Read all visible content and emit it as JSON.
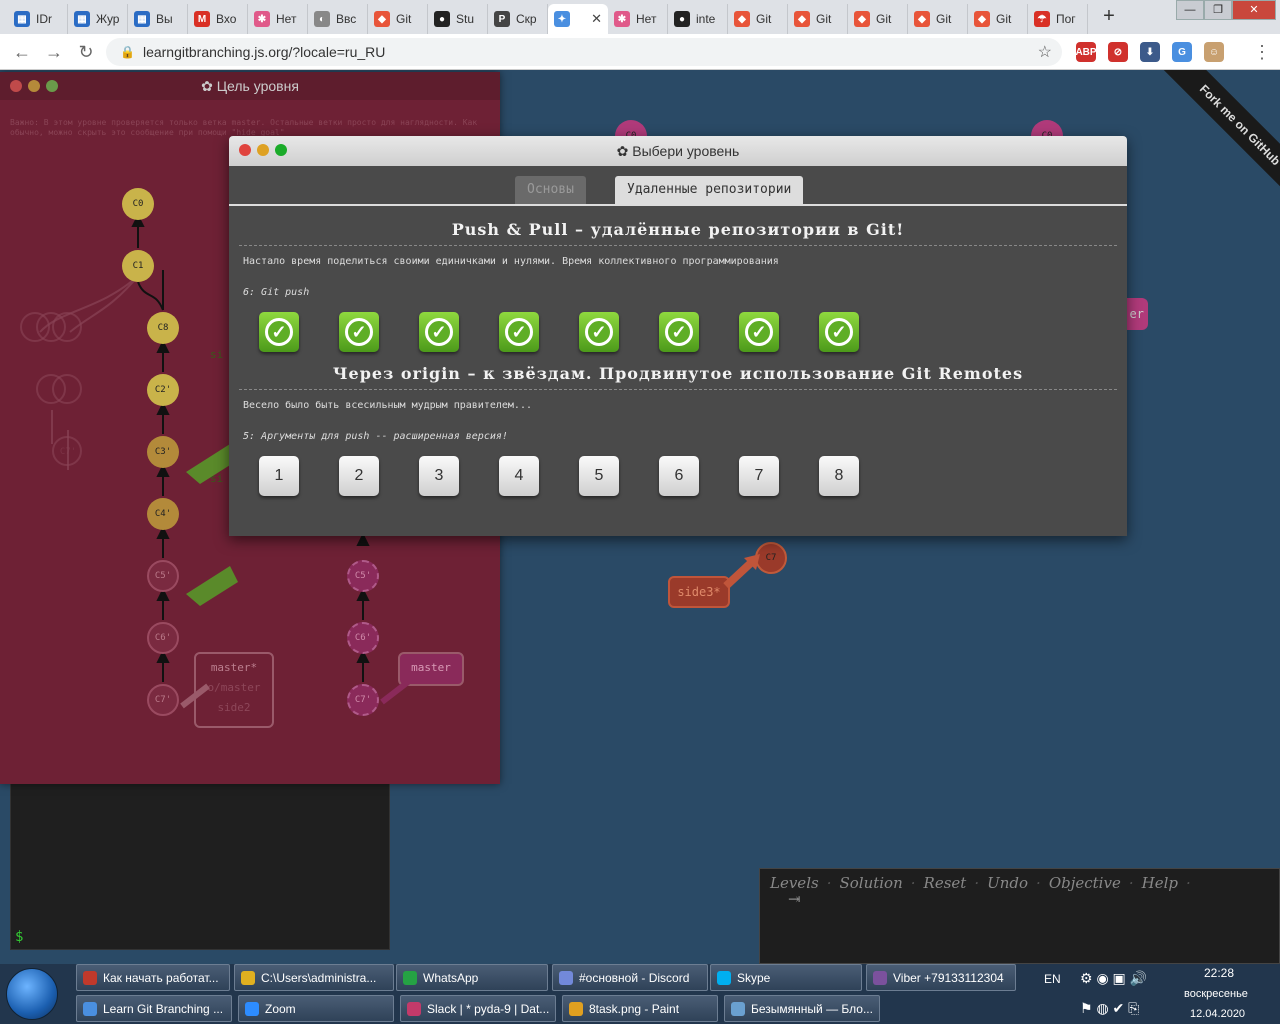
{
  "browser": {
    "tabs": [
      {
        "label": "IDr",
        "color": "#2b6cc4",
        "glyph": "▦"
      },
      {
        "label": "Жур",
        "color": "#2b6cc4",
        "glyph": "▦"
      },
      {
        "label": "Вы",
        "color": "#2b6cc4",
        "glyph": "▦"
      },
      {
        "label": "Вхо",
        "color": "#d93025",
        "glyph": "M"
      },
      {
        "label": "Нет",
        "color": "#e05a8a",
        "glyph": "✱"
      },
      {
        "label": "Ввс",
        "color": "#888888",
        "glyph": "◐"
      },
      {
        "label": "Git",
        "color": "#e8553a",
        "glyph": "◆"
      },
      {
        "label": "Stu",
        "color": "#222222",
        "glyph": "●"
      },
      {
        "label": "Скр",
        "color": "#444444",
        "glyph": "P"
      },
      {
        "label": "",
        "color": "#4a8fe0",
        "glyph": "✦",
        "active": true
      },
      {
        "label": "Нет",
        "color": "#e05a8a",
        "glyph": "✱"
      },
      {
        "label": "inte",
        "color": "#222222",
        "glyph": "●"
      },
      {
        "label": "Git",
        "color": "#e8553a",
        "glyph": "◆"
      },
      {
        "label": "Git",
        "color": "#e8553a",
        "glyph": "◆"
      },
      {
        "label": "Git",
        "color": "#e8553a",
        "glyph": "◆"
      },
      {
        "label": "Git",
        "color": "#e8553a",
        "glyph": "◆"
      },
      {
        "label": "Git",
        "color": "#e8553a",
        "glyph": "◆"
      },
      {
        "label": "Пог",
        "color": "#d93025",
        "glyph": "☂"
      }
    ],
    "close_tab_glyph": "✕",
    "new_tab_glyph": "+",
    "url": "learngitbranching.js.org/?locale=ru_RU",
    "window_controls": [
      "—",
      "❐",
      "✕"
    ],
    "extensions": [
      {
        "name": "abp-icon",
        "text": "ABP",
        "color": "#d0312d"
      },
      {
        "name": "block-icon",
        "text": "⊘",
        "color": "#d0312d"
      },
      {
        "name": "download-icon",
        "text": "⬇",
        "color": "#3c5a8a"
      },
      {
        "name": "translate-icon",
        "text": "G",
        "color": "#4a8fe0"
      },
      {
        "name": "profile-avatar",
        "text": "☺",
        "color": "#c8a070"
      }
    ]
  },
  "goal_window": {
    "title": "✿ Цель уровня",
    "note": "Важно: В этом уровне проверяется только ветка master. Остальные ветки просто для наглядности. Как обычно, можно скрыть это сообщение при помощи \"hide goal\"",
    "nodes": [
      "C0",
      "C1",
      "C8",
      "C2'",
      "C3'",
      "C4'",
      "C5'",
      "C6'",
      "C7'",
      "C5'",
      "C6'",
      "C7'",
      "C7'"
    ],
    "branch_left": [
      "master*",
      "o/master",
      "side2"
    ],
    "branch_right": "master",
    "side_label": "si"
  },
  "main_view": {
    "nodes": [
      "C0",
      "C0",
      "C7"
    ],
    "side_tag": "side3*",
    "right_tag": "er",
    "ribbon": "Fork me on GitHub"
  },
  "level_window": {
    "title": "✿ Выбери уровень",
    "tabs": [
      {
        "label": "Основы",
        "active": false
      },
      {
        "label": "Удаленные репозитории",
        "active": true
      }
    ],
    "sections": [
      {
        "title": "Push & Pull – удалённые репозитории в Git!",
        "desc": "Настало время поделиться своими единичками и нулями. Время коллективного программирования",
        "current": "6: Git push",
        "levels": [
          "✓",
          "✓",
          "✓",
          "✓",
          "✓",
          "✓",
          "✓",
          "✓"
        ]
      },
      {
        "title": "Через origin – к звёздам. Продвинутое использование Git Remotes",
        "desc": "Весело было быть всесильным мудрым правителем...",
        "current": "5: Аргументы для push -- расширенная версия!",
        "levels": [
          "1",
          "2",
          "3",
          "4",
          "5",
          "6",
          "7",
          "8"
        ]
      }
    ]
  },
  "command_bar": {
    "links": [
      "Levels",
      "Solution",
      "Reset",
      "Undo",
      "Objective",
      "Help"
    ],
    "separator": "·",
    "exit_glyph": "⇥",
    "prompt": "$"
  },
  "taskbar": {
    "row1": [
      {
        "label": "Как начать работат...",
        "color": "#c0392b"
      },
      {
        "label": "C:\\Users\\administra...",
        "color": "#e0b020"
      },
      {
        "label": "WhatsApp",
        "color": "#25a244"
      },
      {
        "label": "#основной - Discord",
        "color": "#7289da"
      },
      {
        "label": "Skype",
        "color": "#00aff0"
      },
      {
        "label": "Viber +79133112304",
        "color": "#7b519d"
      }
    ],
    "row2": [
      {
        "label": "Learn Git Branching ...",
        "color": "#4a8fe0"
      },
      {
        "label": "Zoom",
        "color": "#2d8cff"
      },
      {
        "label": "Slack | * pyda-9 | Dat...",
        "color": "#c33a6a"
      },
      {
        "label": "8task.png - Paint",
        "color": "#e0a020"
      },
      {
        "label": "Безымянный — Бло...",
        "color": "#6aa0d0"
      }
    ],
    "lang": "EN",
    "time": "22:28",
    "day": "воскресенье",
    "date": "12.04.2020"
  }
}
